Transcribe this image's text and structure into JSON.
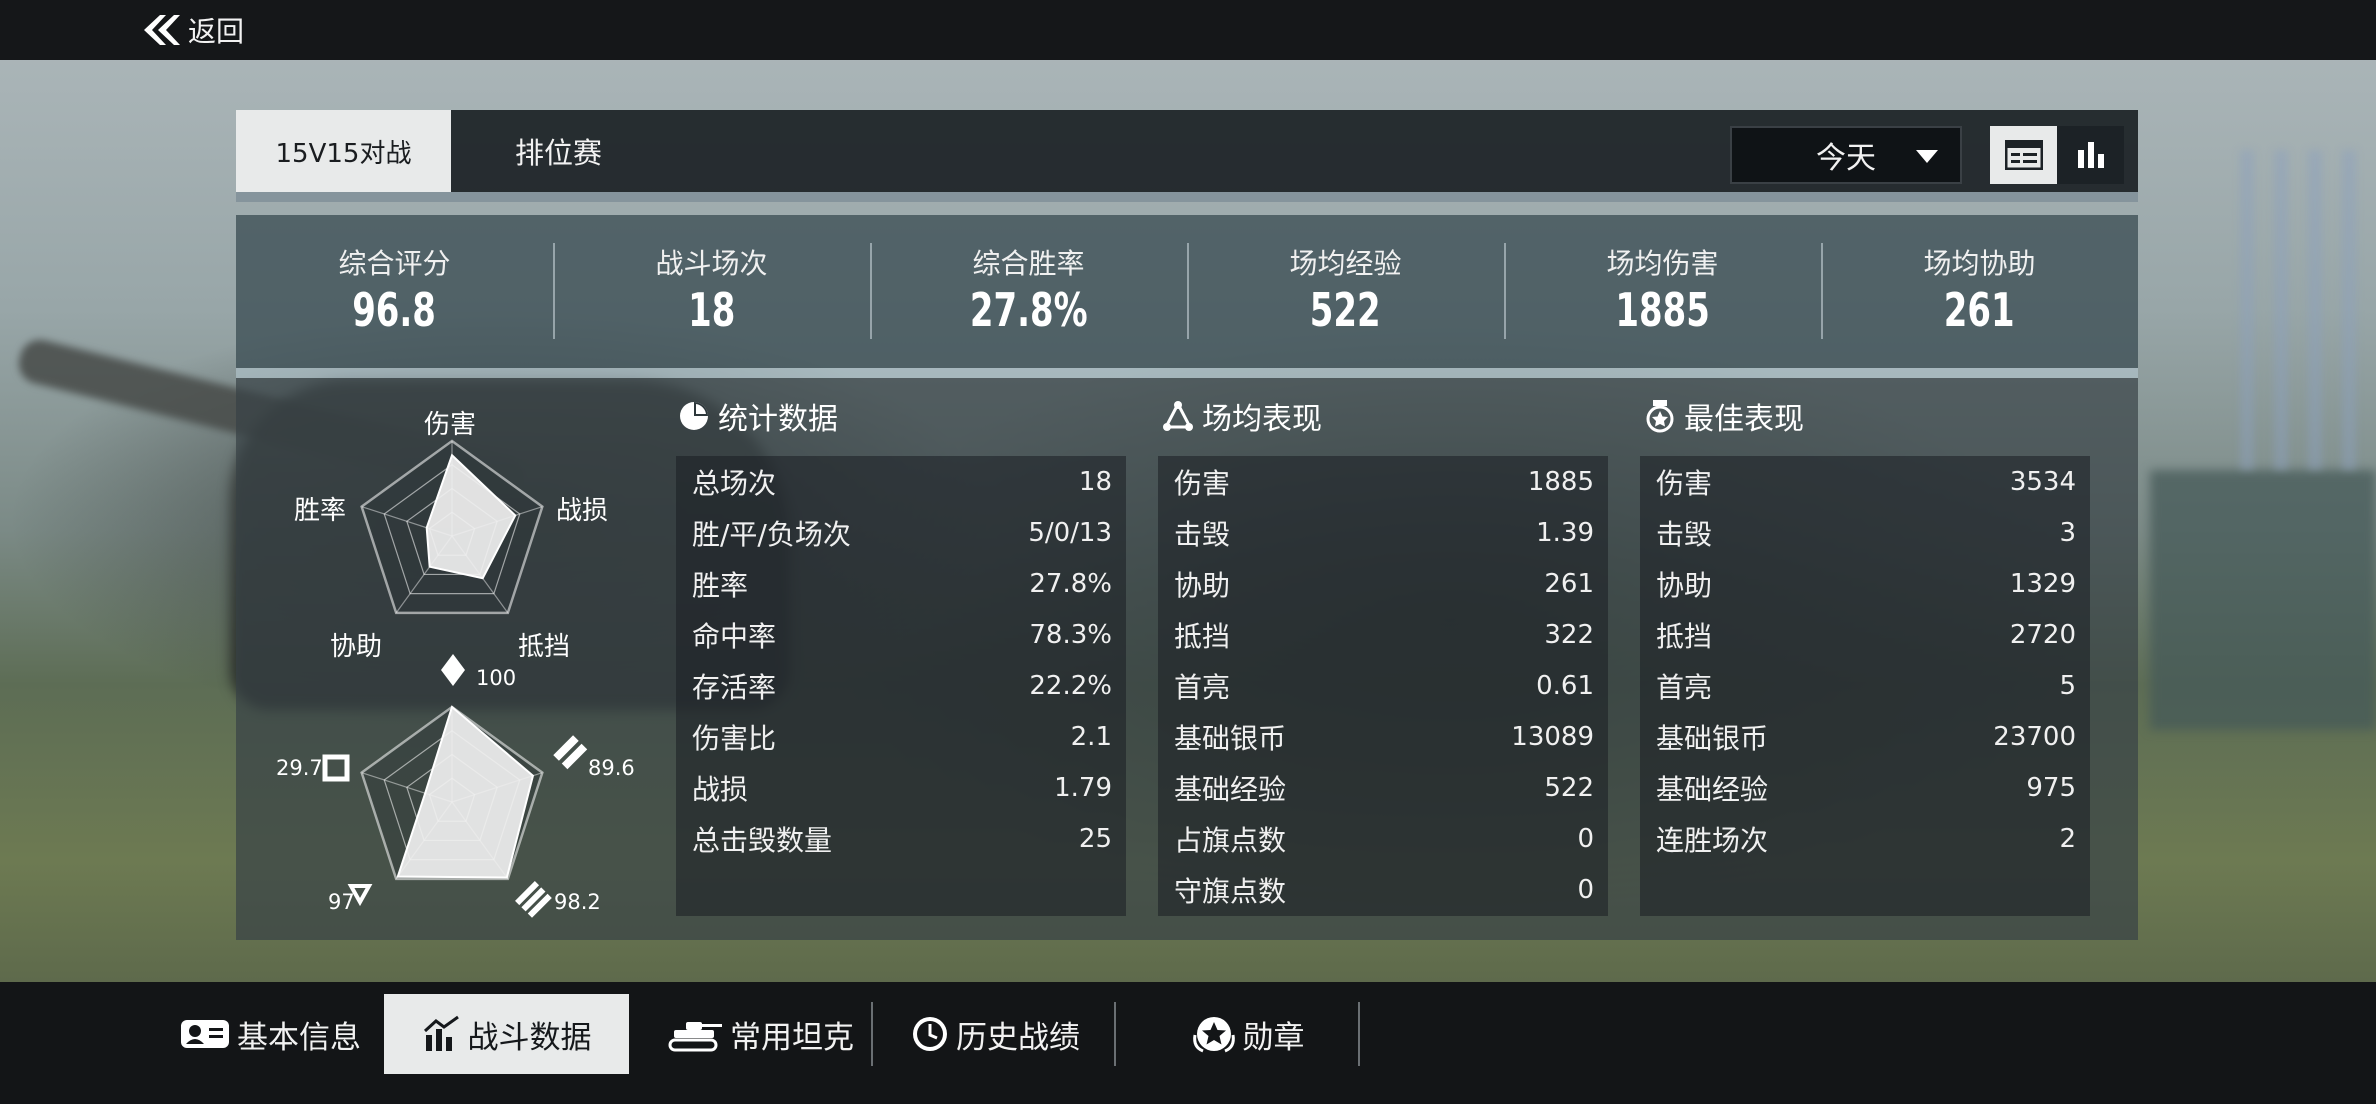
{
  "header": {
    "back_label": "返回"
  },
  "mode_tabs": [
    {
      "label": "15V15对战",
      "active": true
    },
    {
      "label": "排位赛",
      "active": false
    }
  ],
  "date_filter": {
    "selected": "今天"
  },
  "view_toggle": {
    "active": "list-view",
    "options": [
      "list-view-icon",
      "chart-view-icon"
    ]
  },
  "summary": [
    {
      "label": "综合评分",
      "value": "96.8"
    },
    {
      "label": "战斗场次",
      "value": "18"
    },
    {
      "label": "综合胜率",
      "value": "27.8%"
    },
    {
      "label": "场均经验",
      "value": "522"
    },
    {
      "label": "场均伤害",
      "value": "1885"
    },
    {
      "label": "场均协助",
      "value": "261"
    }
  ],
  "radar_top": {
    "labels": [
      "伤害",
      "战损",
      "抵挡",
      "协助",
      "胜率"
    ],
    "values": [
      0.85,
      0.7,
      0.55,
      0.4,
      0.28
    ]
  },
  "radar_bottom": {
    "values_text": [
      "100",
      "89.6",
      "98.2",
      "97",
      "29.7"
    ],
    "values": [
      100,
      89.6,
      98.2,
      97,
      29.7
    ],
    "max": 100
  },
  "stats": {
    "title": "统计数据",
    "rows": [
      {
        "k": "总场次",
        "v": "18"
      },
      {
        "k": "胜/平/负场次",
        "v": "5/0/13"
      },
      {
        "k": "胜率",
        "v": "27.8%"
      },
      {
        "k": "命中率",
        "v": "78.3%"
      },
      {
        "k": "存活率",
        "v": "22.2%"
      },
      {
        "k": "伤害比",
        "v": "2.1"
      },
      {
        "k": "战损",
        "v": "1.79"
      },
      {
        "k": "总击毁数量",
        "v": "25"
      }
    ]
  },
  "average": {
    "title": "场均表现",
    "rows": [
      {
        "k": "伤害",
        "v": "1885"
      },
      {
        "k": "击毁",
        "v": "1.39"
      },
      {
        "k": "协助",
        "v": "261"
      },
      {
        "k": "抵挡",
        "v": "322"
      },
      {
        "k": "首亮",
        "v": "0.61"
      },
      {
        "k": "基础银币",
        "v": "13089"
      },
      {
        "k": "基础经验",
        "v": "522"
      },
      {
        "k": "占旗点数",
        "v": "0"
      },
      {
        "k": "守旗点数",
        "v": "0"
      }
    ]
  },
  "best": {
    "title": "最佳表现",
    "rows": [
      {
        "k": "伤害",
        "v": "3534"
      },
      {
        "k": "击毁",
        "v": "3"
      },
      {
        "k": "协助",
        "v": "1329"
      },
      {
        "k": "抵挡",
        "v": "2720"
      },
      {
        "k": "首亮",
        "v": "5"
      },
      {
        "k": "基础银币",
        "v": "23700"
      },
      {
        "k": "基础经验",
        "v": "975"
      },
      {
        "k": "连胜场次",
        "v": "2"
      }
    ]
  },
  "bottom_nav": [
    {
      "label": "基本信息",
      "icon": "id-card-icon",
      "active": false
    },
    {
      "label": "战斗数据",
      "icon": "bar-chart-icon",
      "active": true
    },
    {
      "label": "常用坦克",
      "icon": "tank-icon",
      "active": false
    },
    {
      "label": "历史战绩",
      "icon": "clock-icon",
      "active": false
    },
    {
      "label": "勋章",
      "icon": "medal-icon",
      "active": false
    }
  ],
  "colors": {
    "active_tab_bg": "#e8eaea",
    "panel_bg": "#374246",
    "accent_line": "#b9cdd7"
  }
}
